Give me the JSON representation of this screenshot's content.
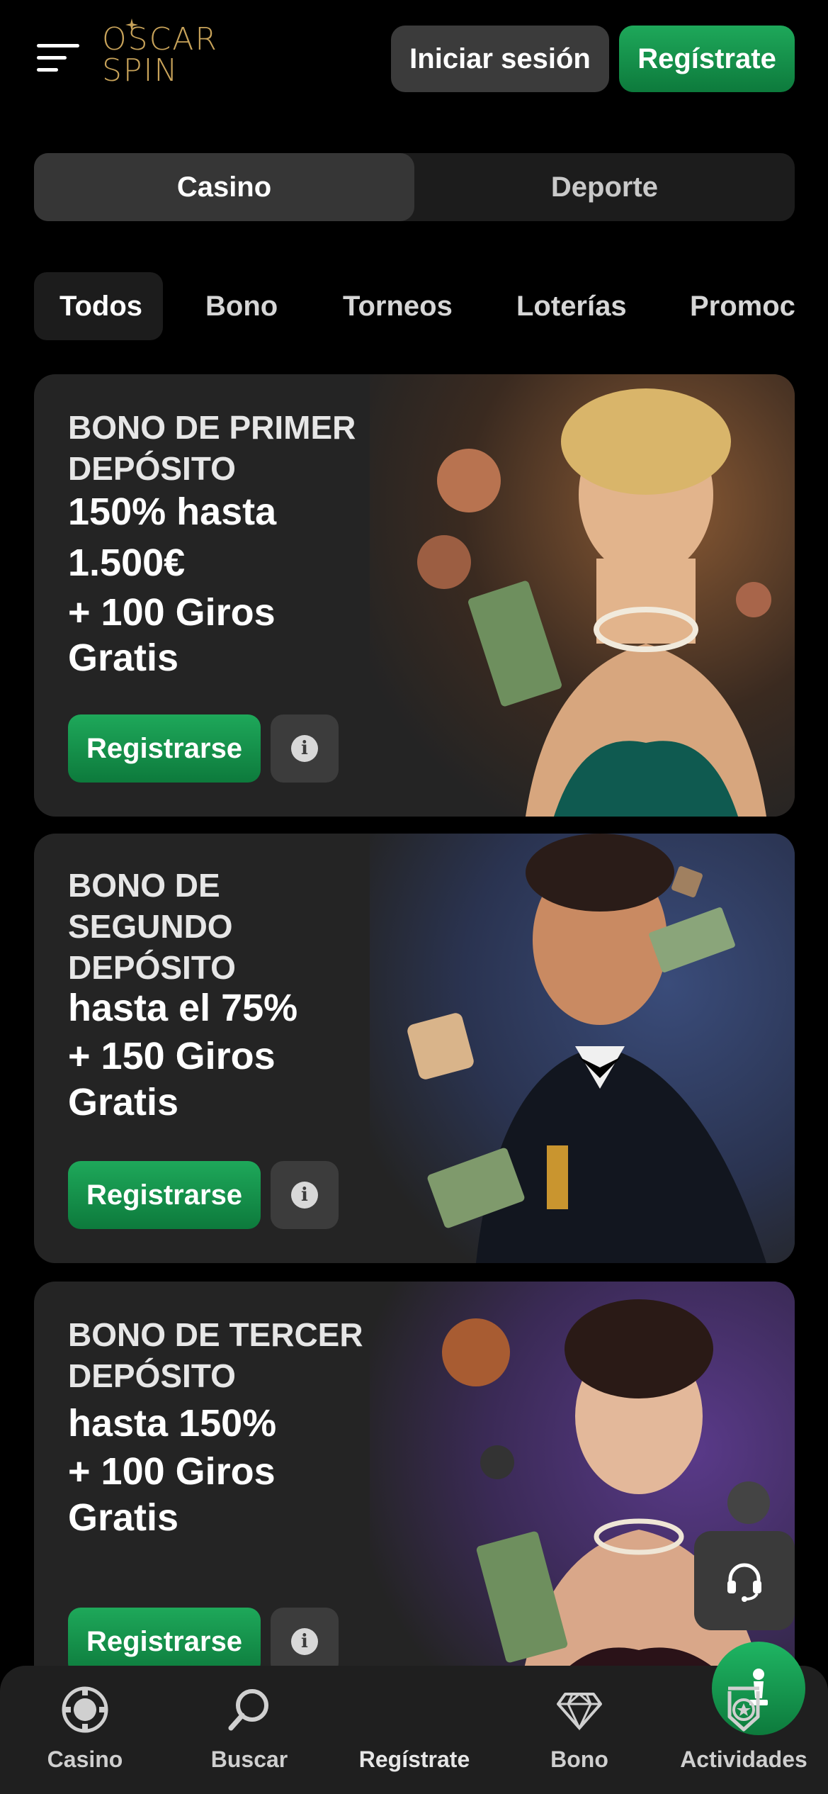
{
  "header": {
    "logo_line1": "OSCAR",
    "logo_line2": "SPIN",
    "login_label": "Iniciar sesión",
    "register_label": "Regístrate"
  },
  "segment": {
    "tabs": [
      {
        "label": "Casino",
        "active": true
      },
      {
        "label": "Deporte",
        "active": false
      }
    ]
  },
  "filters": [
    {
      "label": "Todos",
      "active": true
    },
    {
      "label": "Bono"
    },
    {
      "label": "Torneos"
    },
    {
      "label": "Loterías"
    },
    {
      "label": "Promoci"
    }
  ],
  "promos": [
    {
      "title_lines": [
        "BONO DE PRIMER",
        "DEPÓSITO"
      ],
      "offer_lines": [
        "150% hasta",
        "1.500€",
        "+ 100 Giros",
        "Gratis"
      ],
      "cta": "Registrarse",
      "info_icon": "info-icon"
    },
    {
      "title_lines": [
        "BONO DE",
        "SEGUNDO",
        "DEPÓSITO"
      ],
      "offer_lines": [
        "hasta el 75%",
        "+ 150 Giros",
        "Gratis"
      ],
      "cta": "Registrarse",
      "info_icon": "info-icon"
    },
    {
      "title_lines": [
        "BONO DE TERCER",
        "DEPÓSITO"
      ],
      "offer_lines": [
        "hasta 150%",
        "+ 100 Giros",
        "Gratis"
      ],
      "cta": "Registrarse",
      "info_icon": "info-icon"
    }
  ],
  "support_icon": "headset-icon",
  "bottom_nav": [
    {
      "label": "Casino",
      "icon": "chip-icon"
    },
    {
      "label": "Buscar",
      "icon": "search-icon"
    },
    {
      "label": "Regístrate",
      "icon": "user-figure-icon"
    },
    {
      "label": "Bono",
      "icon": "diamond-icon"
    },
    {
      "label": "Actividades",
      "icon": "medal-icon"
    }
  ],
  "colors": {
    "background": "#000000",
    "accent_green": "#169548",
    "card": "#242424",
    "logo_gold": "#c8a35a"
  }
}
